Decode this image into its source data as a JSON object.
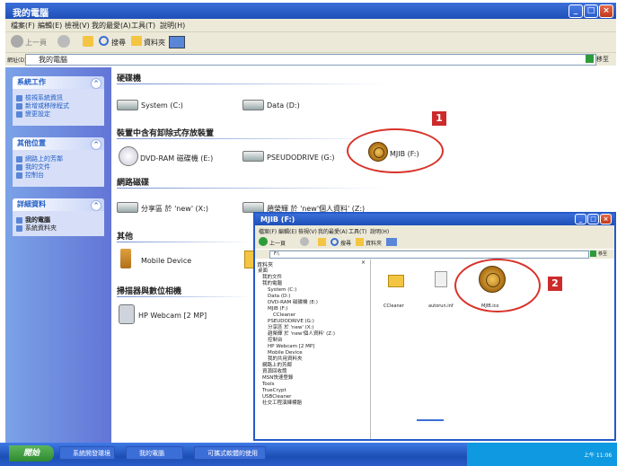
{
  "window": {
    "title": "我的電腦"
  },
  "menu": [
    "檔案(F)",
    "編輯(E)",
    "檢視(V)",
    "我的最愛(A)",
    "工具(T)",
    "說明(H)"
  ],
  "toolbar": {
    "back": "上一頁",
    "search": "搜尋",
    "folders": "資料夾"
  },
  "address": {
    "label": "網址(D)",
    "value": "我的電腦",
    "go": "移至"
  },
  "left_panels": [
    {
      "title": "系統工作",
      "items": [
        "檢視系統資訊",
        "新增或移除程式",
        "變更設定"
      ]
    },
    {
      "title": "其他位置",
      "items": [
        "網路上的芳鄰",
        "我的文件",
        "控制台"
      ]
    },
    {
      "title": "詳細資料",
      "items": [
        "我的電腦",
        "系統資料夾"
      ]
    }
  ],
  "sections": {
    "hdd": "硬碟機",
    "removable": "裝置中含有卸除式存放裝置",
    "network": "網路磁碟",
    "other": "其他",
    "scanners": "掃描器與數位相機"
  },
  "drives": {
    "system": "System (C:)",
    "data": "Data (D:)",
    "dvd": "DVD-RAM 磁碟機 (E:)",
    "pseudo": "PSEUDODRIVE (G:)",
    "mjib": "MJIB (F:)",
    "net1": "分享區 於 'new' (X:)",
    "net2": "趙榮輝 於 'new'個人資料' (Z:)",
    "mobile": "Mobile Device",
    "webcam": "HP Webcam [2 MP]"
  },
  "callouts": [
    "1",
    "2"
  ],
  "child": {
    "title": "MJIB (F:)",
    "menu": [
      "檔案(F)",
      "編輯(E)",
      "檢視(V)",
      "我的最愛(A)",
      "工具(T)",
      "說明(H)"
    ],
    "address": "F:\\",
    "go": "移至",
    "tree_header": "資料夾",
    "tree": [
      "桌面",
      "我的文件",
      "我的電腦",
      "System (C:)",
      "Data (D:)",
      "DVD-RAM 磁碟機 (E:)",
      "MJIB (F:)",
      "CCleaner",
      "PSEUDODRIVE (G:)",
      "分享區 於 'new' (X:)",
      "趙榮輝 於 'new'個人資料' (Z:)",
      "控制台",
      "HP Webcam [2 MP]",
      "Mobile Device",
      "我的共用資料夾",
      "網路上的芳鄰",
      "資源回收筒",
      "MSN快速登錄",
      "Tools",
      "TrueCrypt",
      "USBCleaner",
      "社交工程演練標題"
    ],
    "files": [
      "CCleaner",
      "autorun.inf",
      "MJIB.ico"
    ]
  },
  "taskbar": {
    "start": "開始",
    "buttons": [
      "系統開發環境",
      "我的電腦",
      "可攜式軟體的使用"
    ],
    "clock": "上午 11:06"
  }
}
